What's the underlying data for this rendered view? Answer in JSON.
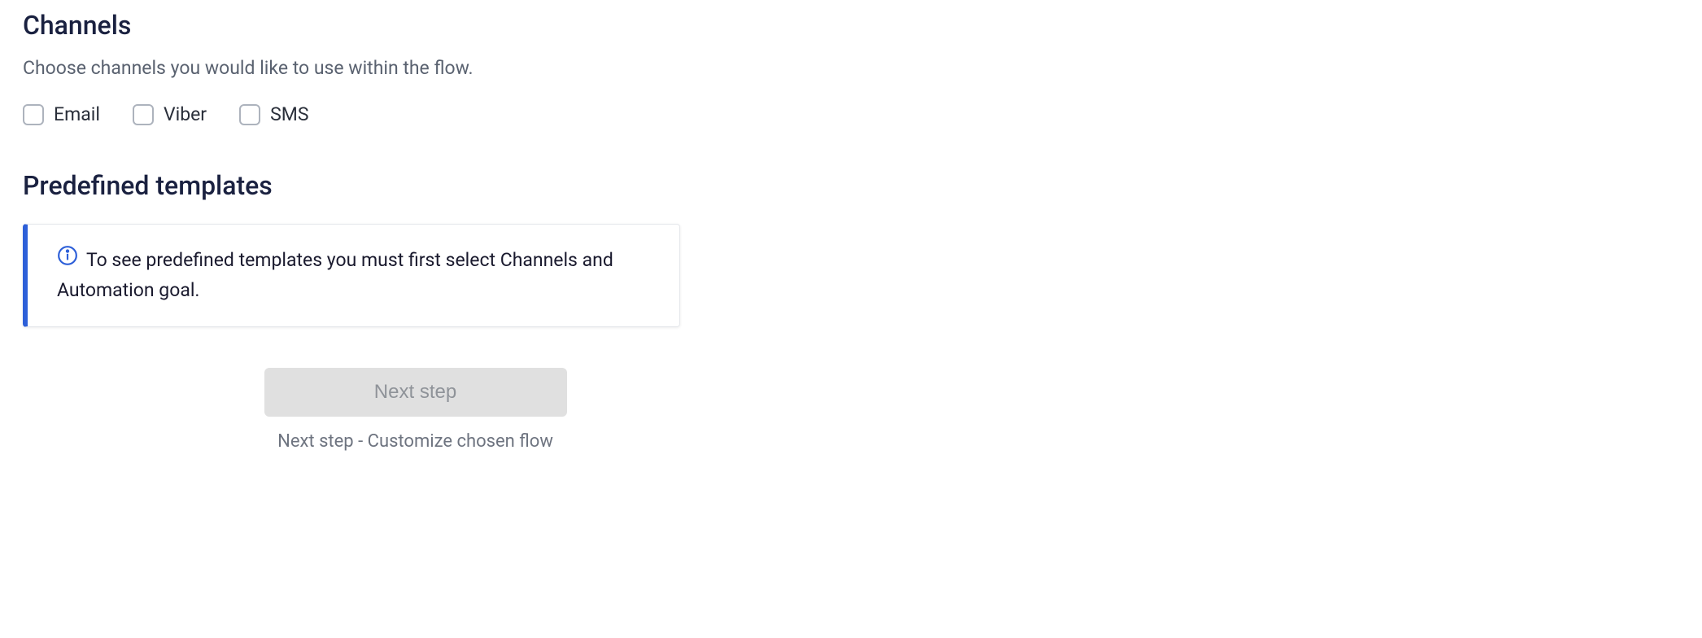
{
  "channels": {
    "title": "Channels",
    "subtitle": "Choose channels you would like to use within the flow.",
    "options": {
      "email": "Email",
      "viber": "Viber",
      "sms": "SMS"
    }
  },
  "templates": {
    "title": "Predefined templates",
    "info_text": "To see predefined templates you must first select Channels and Automation goal."
  },
  "footer": {
    "next_button": "Next step",
    "next_hint": "Next step - Customize chosen flow"
  }
}
